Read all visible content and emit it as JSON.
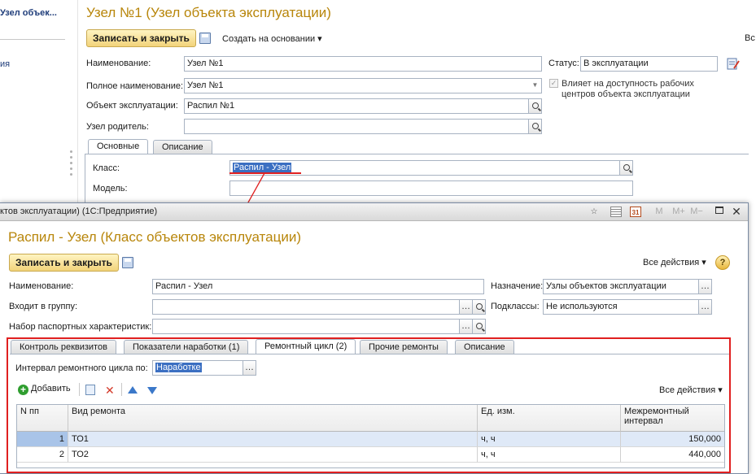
{
  "background_window": {
    "left_panel": {
      "item1": "Узел объек...",
      "item2": "ия"
    },
    "title": "Узел №1 (Узел объекта эксплуатации)",
    "toolbar": {
      "save_close_label": "Записать и закрыть",
      "create_based_on_label": "Создать на основании ▾",
      "all_actions_label": "Вс"
    },
    "fields": {
      "name_label": "Наименование:",
      "name_value": "Узел №1",
      "full_name_label": "Полное наименование:",
      "full_name_value": "Узел №1",
      "object_label": "Объект эксплуатации:",
      "object_value": "Распил №1",
      "parent_label": "Узел родитель:",
      "parent_value": "",
      "status_label": "Статус:",
      "status_value": "В эксплуатации",
      "affects_label_line1": "Влияет на доступность рабочих",
      "affects_label_line2": "центров объекта эксплуатации"
    },
    "tabs": [
      "Основные",
      "Описание"
    ],
    "tab_fields": {
      "class_label": "Класс:",
      "class_value": "Распил - Узел",
      "model_label": "Модель:",
      "model_value": ""
    }
  },
  "foreground_window": {
    "caption": "ктов эксплуатации)  (1С:Предприятие)",
    "caption_buttons": [
      "M",
      "M+",
      "M−"
    ],
    "title": "Распил - Узел (Класс объектов эксплуатации)",
    "toolbar": {
      "save_close_label": "Записать и закрыть",
      "all_actions_label": "Все действия ▾",
      "help_label": "?"
    },
    "fields": {
      "name_label": "Наименование:",
      "name_value": "Распил - Узел",
      "group_label": "Входит в группу:",
      "group_value": "",
      "passport_label": "Набор паспортных характеристик:",
      "passport_value": "",
      "purpose_label": "Назначение:",
      "purpose_value": "Узлы объектов эксплуатации",
      "subclasses_label": "Подклассы:",
      "subclasses_value": "Не используются"
    },
    "tabs": [
      "Контроль реквизитов",
      "Показатели наработки (1)",
      "Ремонтный цикл (2)",
      "Прочие ремонты",
      "Описание"
    ],
    "repair_cycle": {
      "interval_label": "Интервал ремонтного цикла по:",
      "interval_value": "Наработке",
      "add_label": "Добавить",
      "all_actions_label": "Все действия ▾",
      "columns": [
        "N пп",
        "Вид ремонта",
        "Ед. изм.",
        "Межремонтный интервал"
      ],
      "rows": [
        {
          "n": "1",
          "kind": "ТО1",
          "unit": "ч, ч",
          "interval": "150,000"
        },
        {
          "n": "2",
          "kind": "ТО2",
          "unit": "ч, ч",
          "interval": "440,000"
        }
      ]
    }
  },
  "colors": {
    "title": "#b8860b",
    "highlight_box": "#e02020",
    "selection": "#3b6fc2"
  }
}
